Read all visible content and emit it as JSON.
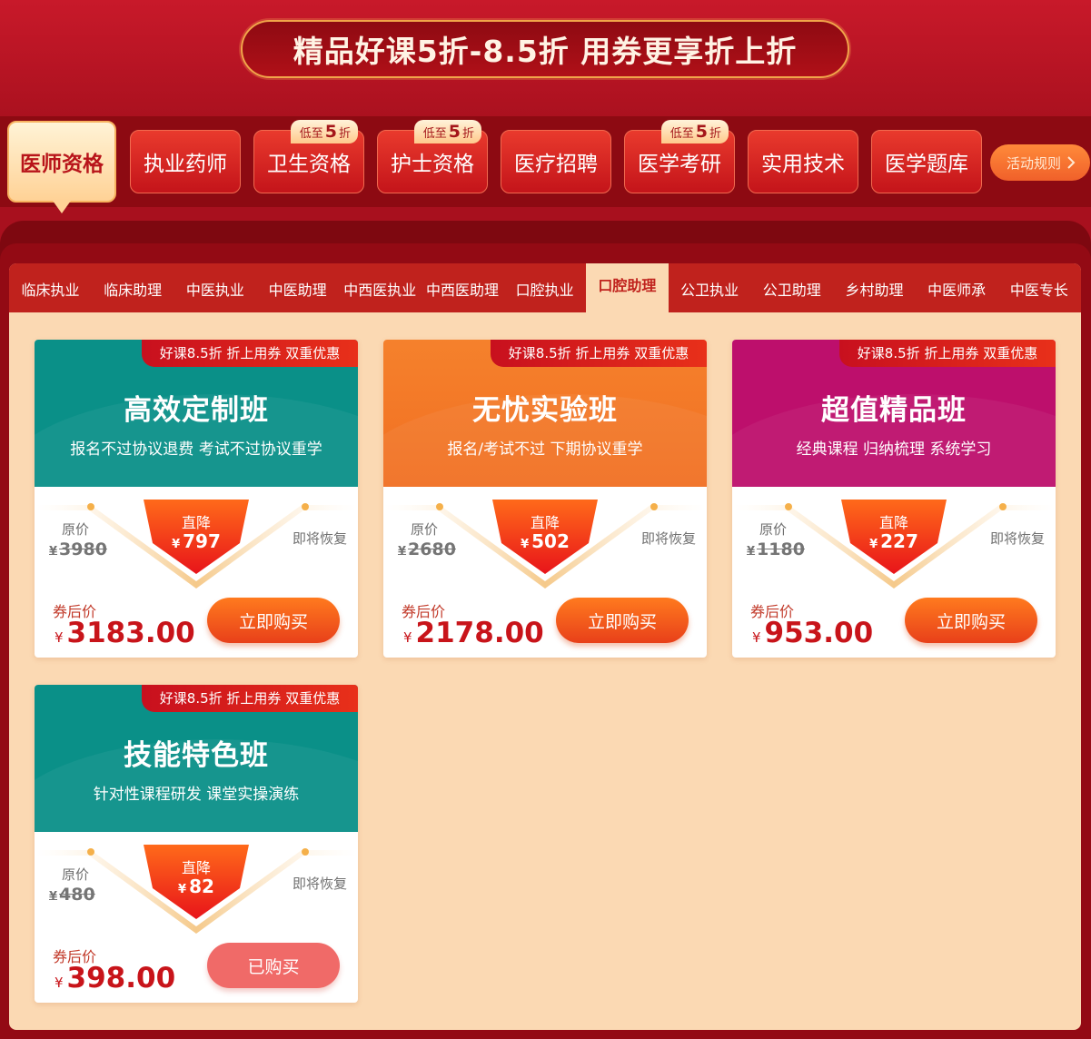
{
  "banner": {
    "title": "精品好课5折-8.5折 用券更享折上折"
  },
  "categories": [
    {
      "label": "医师资格",
      "active": true,
      "tag": ""
    },
    {
      "label": "执业药师",
      "active": false,
      "tag": ""
    },
    {
      "label": "卫生资格",
      "active": false,
      "tag": "低至5折",
      "tag_prefix": "低至",
      "tag_num": "5",
      "tag_suffix": "折"
    },
    {
      "label": "护士资格",
      "active": false,
      "tag": "低至5折",
      "tag_prefix": "低至",
      "tag_num": "5",
      "tag_suffix": "折"
    },
    {
      "label": "医疗招聘",
      "active": false,
      "tag": ""
    },
    {
      "label": "医学考研",
      "active": false,
      "tag": "低至5折",
      "tag_prefix": "低至",
      "tag_num": "5",
      "tag_suffix": "折"
    },
    {
      "label": "实用技术",
      "active": false,
      "tag": ""
    },
    {
      "label": "医学题库",
      "active": false,
      "tag": ""
    }
  ],
  "rules_button": {
    "label": "活动规则",
    "icon": "chevron-right-icon"
  },
  "sub_tabs": [
    {
      "label": "临床执业",
      "active": false
    },
    {
      "label": "临床助理",
      "active": false
    },
    {
      "label": "中医执业",
      "active": false
    },
    {
      "label": "中医助理",
      "active": false
    },
    {
      "label": "中西医执业",
      "active": false
    },
    {
      "label": "中西医助理",
      "active": false
    },
    {
      "label": "口腔执业",
      "active": false
    },
    {
      "label": "口腔助理",
      "active": true
    },
    {
      "label": "公卫执业",
      "active": false
    },
    {
      "label": "公卫助理",
      "active": false
    },
    {
      "label": "乡村助理",
      "active": false
    },
    {
      "label": "中医师承",
      "active": false
    },
    {
      "label": "中医专长",
      "active": false
    }
  ],
  "card_common": {
    "promo": "好课8.5折 折上用券 双重优惠",
    "orig_label": "原价",
    "drop_label": "直降",
    "restore_label": "即将恢复",
    "after_label": "券后价",
    "currency": "¥"
  },
  "cards": [
    {
      "title": "高效定制班",
      "subtitle": "报名不过协议退费 考试不过协议重学",
      "theme": "teal",
      "orig_price": "3980",
      "drop": "797",
      "after_price": "3183.00",
      "button": "立即购买",
      "bought": false
    },
    {
      "title": "无忧实验班",
      "subtitle": "报名/考试不过 下期协议重学",
      "theme": "orange",
      "orig_price": "2680",
      "drop": "502",
      "after_price": "2178.00",
      "button": "立即购买",
      "bought": false
    },
    {
      "title": "超值精品班",
      "subtitle": "经典课程 归纳梳理 系统学习",
      "theme": "magenta",
      "orig_price": "1180",
      "drop": "227",
      "after_price": "953.00",
      "button": "立即购买",
      "bought": false
    },
    {
      "title": "技能特色班",
      "subtitle": "针对性课程研发 课堂实操演练",
      "theme": "teal",
      "orig_price": "480",
      "drop": "82",
      "after_price": "398.00",
      "button": "已购买",
      "bought": true
    }
  ],
  "colors": {
    "teal": "#0a9088",
    "orange": "#f3782a",
    "magenta": "#bd0f6c",
    "accent_red": "#c8141a"
  }
}
